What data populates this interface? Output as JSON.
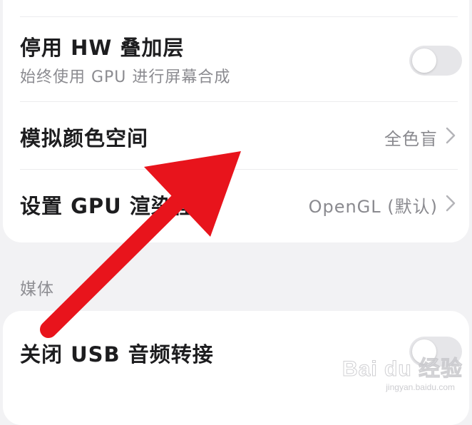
{
  "developer_options": {
    "rows": [
      {
        "title": "停用 HW 叠加层",
        "subtitle": "始终使用 GPU 进行屏幕合成",
        "control": "toggle",
        "enabled": false
      },
      {
        "title": "模拟颜色空间",
        "value": "全色盲",
        "control": "chevron"
      },
      {
        "title": "设置 GPU 渲染程序",
        "value": "OpenGL (默认)",
        "control": "chevron"
      }
    ]
  },
  "media_section": {
    "header": "媒体",
    "rows": [
      {
        "title": "关闭 USB 音频转接",
        "control": "toggle",
        "enabled": false
      }
    ]
  },
  "overlay": {
    "arrow_color": "#e8141c",
    "arrow_icon": "red-pointer-arrow"
  },
  "watermark": {
    "text": "Bai du 经验",
    "sub": "jingyan.baidu.com"
  }
}
